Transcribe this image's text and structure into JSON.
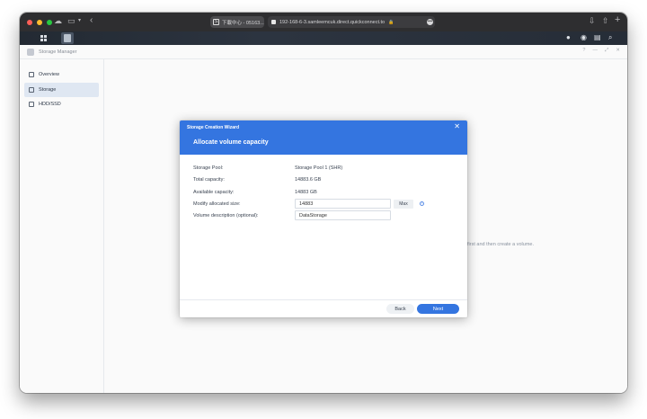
{
  "browser": {
    "tabs": [
      {
        "favicon": "S",
        "label": "下載中心 - 05163..."
      },
      {
        "label": "192-168-6-3.samleemcuk.direct.quickconnect.to"
      }
    ]
  },
  "app": {
    "title": "Storage Manager",
    "window_controls": [
      "?",
      "—",
      "⤢",
      "✕"
    ],
    "sidebar": {
      "items": [
        {
          "label": "Overview",
          "icon": "overview-icon",
          "active": false
        },
        {
          "label": "Storage",
          "icon": "storage-icon",
          "active": true
        },
        {
          "label": "HDD/SSD",
          "icon": "hdd-icon",
          "active": false
        }
      ]
    },
    "empty_hint": "first and then create a volume."
  },
  "wizard": {
    "window_title": "Storage Creation Wizard",
    "heading": "Allocate volume capacity",
    "close_glyph": "✕",
    "fields": {
      "storage_pool": {
        "label": "Storage Pool:",
        "value": "Storage Pool 1 (SHR)"
      },
      "total_capacity": {
        "label": "Total capacity:",
        "value": "14883.6 GB"
      },
      "available_capacity": {
        "label": "Available capacity:",
        "value": "14883 GB"
      },
      "allocated_size": {
        "label": "Modify allocated size:",
        "value": "14883",
        "max_label": "Max"
      },
      "volume_description": {
        "label": "Volume description (optional):",
        "value": "DataStorage"
      }
    },
    "buttons": {
      "back": "Back",
      "next": "Next"
    }
  },
  "colors": {
    "accent": "#3475e0",
    "safari_toolbar": "#2e2e30",
    "dsm_taskbar": "#2a313b",
    "sidebar_active": "#e4ecf7"
  }
}
